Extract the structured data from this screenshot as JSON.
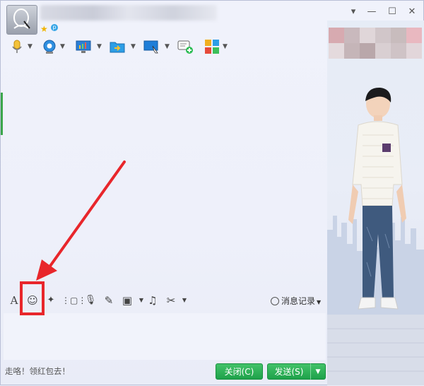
{
  "window": {
    "controls": [
      "▾",
      "—",
      "☐",
      "✕"
    ]
  },
  "toolbar_top": {
    "items": [
      {
        "name": "voice-call",
        "icon": "microphone-icon"
      },
      {
        "name": "video-call",
        "icon": "webcam-icon"
      },
      {
        "name": "remote-desktop",
        "icon": "monitor-chart-icon"
      },
      {
        "name": "send-file",
        "icon": "folder-transfer-icon"
      },
      {
        "name": "screen-share",
        "icon": "screen-cursor-icon"
      },
      {
        "name": "invite-group",
        "icon": "chat-add-icon"
      },
      {
        "name": "apps",
        "icon": "apps-grid-icon"
      }
    ]
  },
  "input_toolbar": {
    "font_label": "A",
    "emoji_label": "☺",
    "magic_label": "✦",
    "shake_label": "⋮▢⋮",
    "voice_label": "🎙",
    "edit_label": "✎",
    "image_label": "▣",
    "music_label": "♫",
    "screenshot_label": "✂",
    "history_label": "消息记录"
  },
  "footer": {
    "status_text": "走咯！领红包去！",
    "close_button": "关闭(C)",
    "send_button": "发送(S)"
  },
  "colors": {
    "accent_green": "#1ea24a",
    "highlight_red": "#e8262b"
  }
}
